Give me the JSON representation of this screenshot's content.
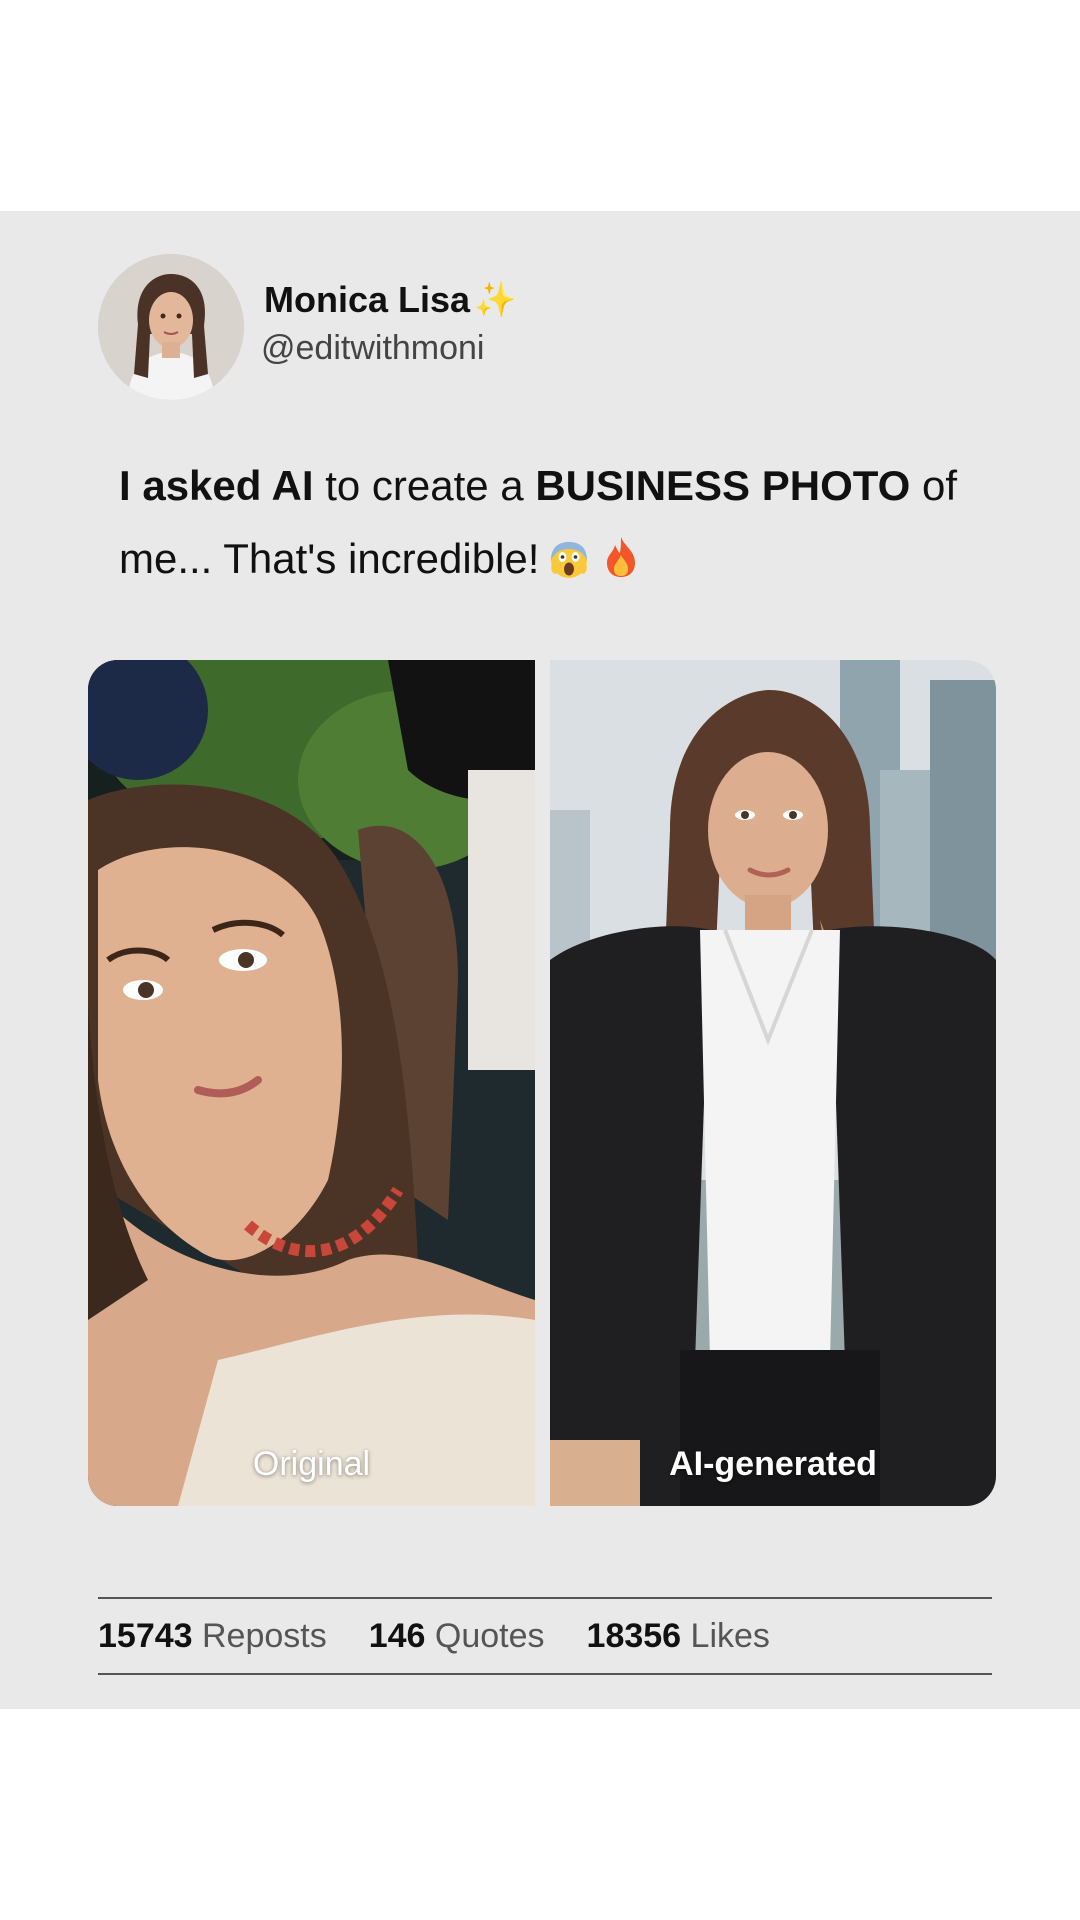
{
  "post": {
    "author": {
      "display_name": "Monica Lisa",
      "badge_emoji": "✨",
      "handle": "@editwithmoni"
    },
    "text": {
      "part1_bold": "I asked AI",
      "part2": " to create a ",
      "part3_bold": "BUSINESS PHOTO",
      "part4": " of me... That's incredible!",
      "emojis": [
        "scream-face-icon",
        "fire-icon"
      ]
    },
    "images": [
      {
        "label": "Original"
      },
      {
        "label": "AI-generated"
      }
    ],
    "stats": {
      "reposts_count": "15743",
      "reposts_label": "Reposts",
      "quotes_count": "146",
      "quotes_label": "Quotes",
      "likes_count": "18356",
      "likes_label": "Likes"
    }
  },
  "colors": {
    "card_background": "#e9e9e9",
    "page_background": "#ffffff",
    "sparkle": "#f2c84b"
  }
}
